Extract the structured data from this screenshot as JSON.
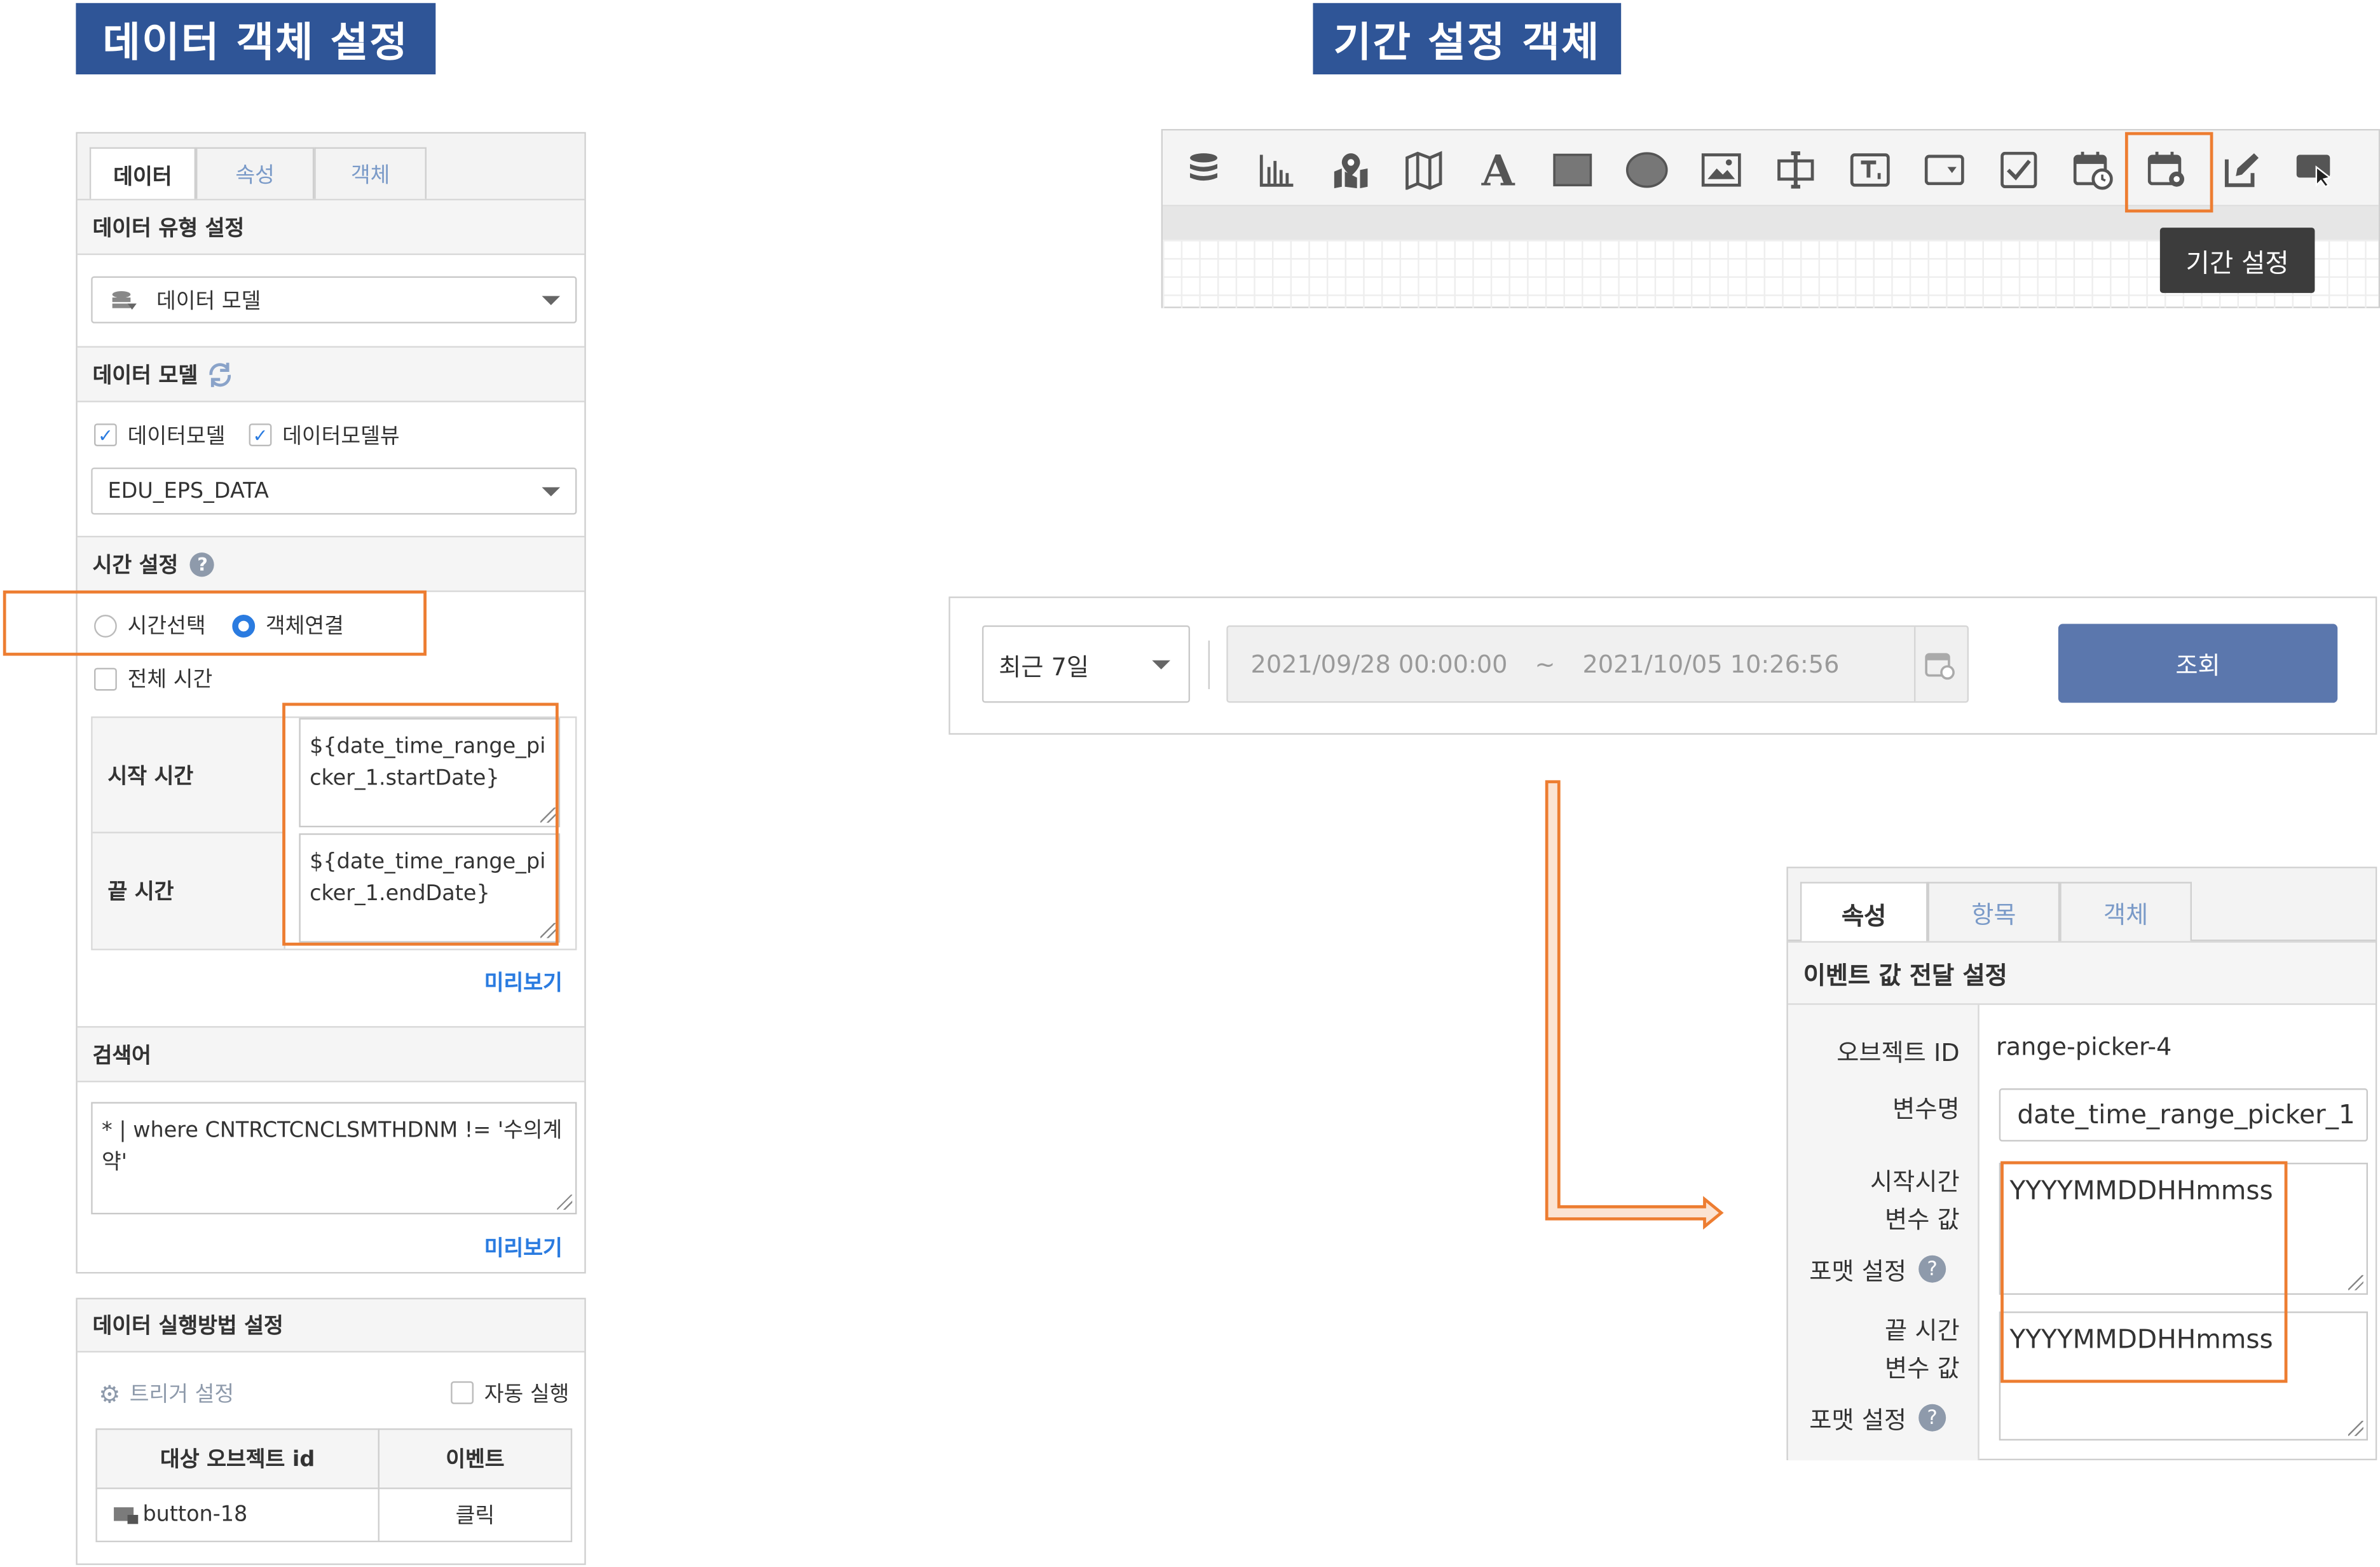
{
  "banners": {
    "left_title": "데이터  객체  설정",
    "right_title": "기간  설정  객체"
  },
  "data_panel": {
    "tabs": [
      "데이터",
      "속성",
      "객체"
    ],
    "data_type_section": "데이터 유형 설정",
    "data_type_value": "데이터 모델",
    "data_model_section": "데이터 모델",
    "checkbox_model": "데이터모델",
    "checkbox_model_view": "데이터모델뷰",
    "model_select_value": "EDU_EPS_DATA",
    "time_section": "시간 설정",
    "radio_time_select": "시간선택",
    "radio_object_link": "객체연결",
    "checkbox_all_time": "전체 시간",
    "start_time_label": "시작 시간",
    "start_time_value": "${date_time_range_picker_1.startDate}",
    "end_time_label": "끝 시간",
    "end_time_value": "${date_time_range_picker_1.endDate}",
    "preview_1": "미리보기",
    "search_section": "검색어",
    "search_query": "* | where CNTRCTCNCLSMTHDNM != '수의계약'",
    "preview_2": "미리보기"
  },
  "exec_panel": {
    "title": "데이터 실행방법 설정",
    "trigger_label": "트리거 설정",
    "auto_run_label": "자동 실행",
    "col_target": "대상 오브젝트 id",
    "col_event": "이벤트",
    "rows": [
      {
        "target": "button-18",
        "event": "클릭"
      }
    ]
  },
  "toolbar": {
    "icons": [
      "database-icon",
      "bar-chart-icon",
      "map-marker-icon",
      "map-icon",
      "text-icon",
      "rectangle-icon",
      "ellipse-icon",
      "image-icon",
      "input-cursor-icon",
      "textbox-icon",
      "dropdown-icon",
      "checkbox-icon",
      "date-picker-icon",
      "range-picker-icon",
      "edit-icon",
      "button-icon"
    ],
    "tooltip": "기간 설정"
  },
  "range_picker": {
    "period_value": "최근 7일",
    "start": "2021/09/28 00:00:00",
    "tilde": "~",
    "end": "2021/10/05 10:26:56",
    "query_button": "조회"
  },
  "props_panel": {
    "tabs": [
      "속성",
      "항목",
      "객체"
    ],
    "section": "이벤트 값 전달 설정",
    "object_id_label": "오브젝트 ID",
    "object_id_value": "range-picker-4",
    "var_name_label": "변수명",
    "var_name_value": "date_time_range_picker_1",
    "start_format_label_1": "시작시간",
    "start_format_label_2": "변수 값",
    "start_format_label_3": "포맷 설정",
    "start_format_value": "YYYYMMDDHHmmss",
    "end_format_label_1": "끝 시간",
    "end_format_label_2": "변수 값",
    "end_format_label_3": "포맷 설정",
    "end_format_value": "YYYYMMDDHHmmss"
  },
  "colors": {
    "banner": "#2f5597",
    "highlight": "#ed7d31",
    "primary_button": "#5b77ad",
    "link": "#2a7be0"
  }
}
